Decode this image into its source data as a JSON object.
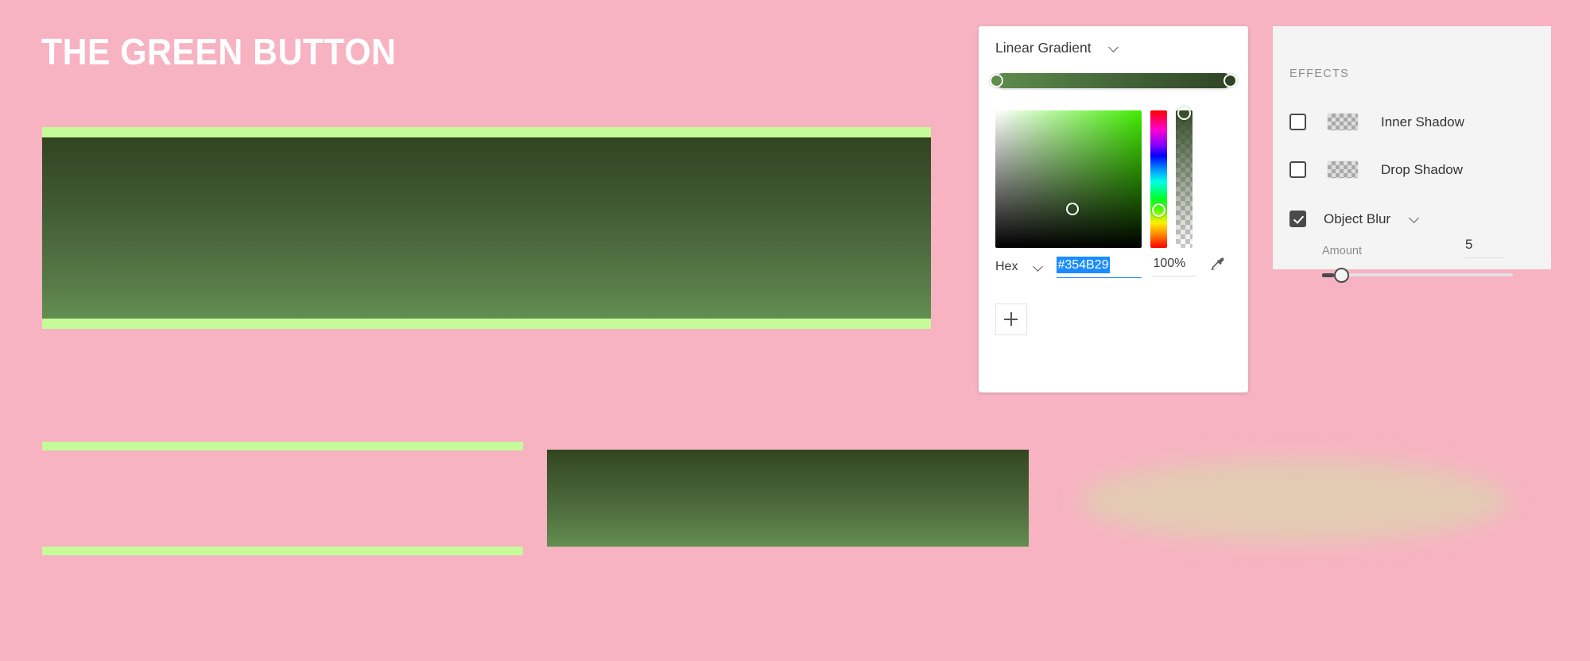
{
  "canvas": {
    "background_color": "#f7b3c2",
    "title": "THE GREEN BUTTON",
    "hero_button": {
      "name": "hero-green-button",
      "bar_color": "#c5fb98",
      "gradient_top": "#31451f",
      "gradient_bottom": "#628f50"
    },
    "outline_button": {
      "name": "outlined-button",
      "bar_color": "#c5fb98"
    },
    "secondary_rect": {
      "gradient_top": "#32461f",
      "gradient_bottom": "#628f50"
    },
    "blur_ellipse": {
      "color": "#e3cbb3",
      "blur": "14px"
    }
  },
  "color_picker": {
    "type_label": "Linear Gradient",
    "gradient_stops": [
      {
        "position": 0,
        "color": "#5e8d4c"
      },
      {
        "position": 100,
        "color": "#2f4426"
      }
    ],
    "hue": "green",
    "mode_label": "Hex",
    "hex_value": "#354B29",
    "opacity_value": "100%",
    "eyedropper_icon": "eyedropper-icon",
    "add_stop_label": "+"
  },
  "effects": {
    "title": "EFFECTS",
    "items": [
      {
        "label": "Inner Shadow",
        "checked": false,
        "has_swatch": true,
        "has_chevron": false
      },
      {
        "label": "Drop Shadow",
        "checked": false,
        "has_swatch": true,
        "has_chevron": false
      },
      {
        "label": "Object Blur",
        "checked": true,
        "has_swatch": false,
        "has_chevron": true
      }
    ],
    "amount": {
      "label": "Amount",
      "value": "5",
      "percent": 6
    }
  }
}
